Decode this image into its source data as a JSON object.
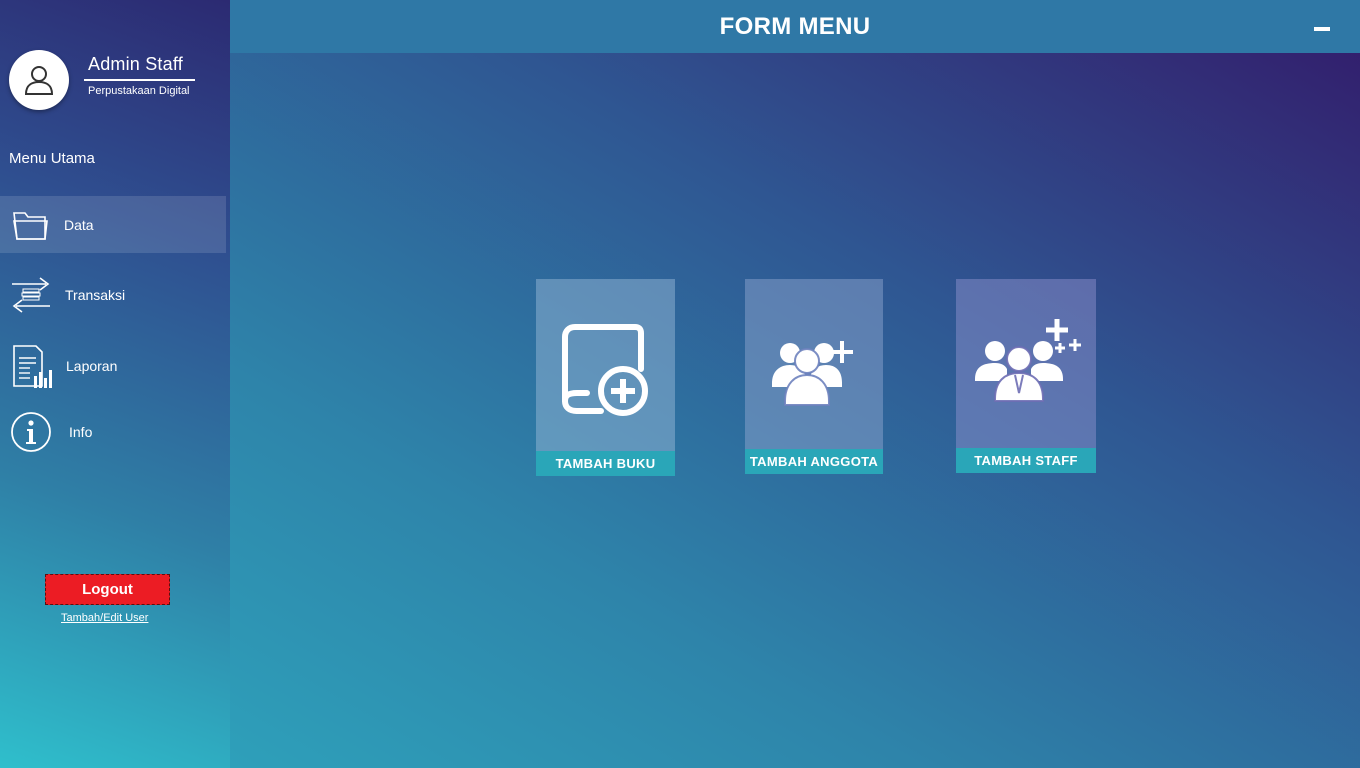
{
  "header": {
    "title": "FORM MENU"
  },
  "user": {
    "name": "Admin Staff",
    "subtitle": "Perpustakaan Digital"
  },
  "sidebar": {
    "menu_title": "Menu Utama",
    "items": [
      {
        "label": "Data",
        "icon": "folder-icon",
        "active": true
      },
      {
        "label": "Transaksi",
        "icon": "transfer-icon",
        "active": false
      },
      {
        "label": "Laporan",
        "icon": "report-icon",
        "active": false
      },
      {
        "label": "Info",
        "icon": "info-icon",
        "active": false
      }
    ],
    "logout_label": "Logout",
    "edit_user_label": "Tambah/Edit User"
  },
  "tiles": [
    {
      "label": "TAMBAH BUKU",
      "icon": "add-book-icon"
    },
    {
      "label": "TAMBAH ANGGOTA",
      "icon": "add-member-icon"
    },
    {
      "label": "TAMBAH STAFF",
      "icon": "add-staff-icon"
    }
  ],
  "colors": {
    "accent": "#2aa6b8",
    "header": "#2f78a6",
    "logout": "#ec1c24"
  }
}
